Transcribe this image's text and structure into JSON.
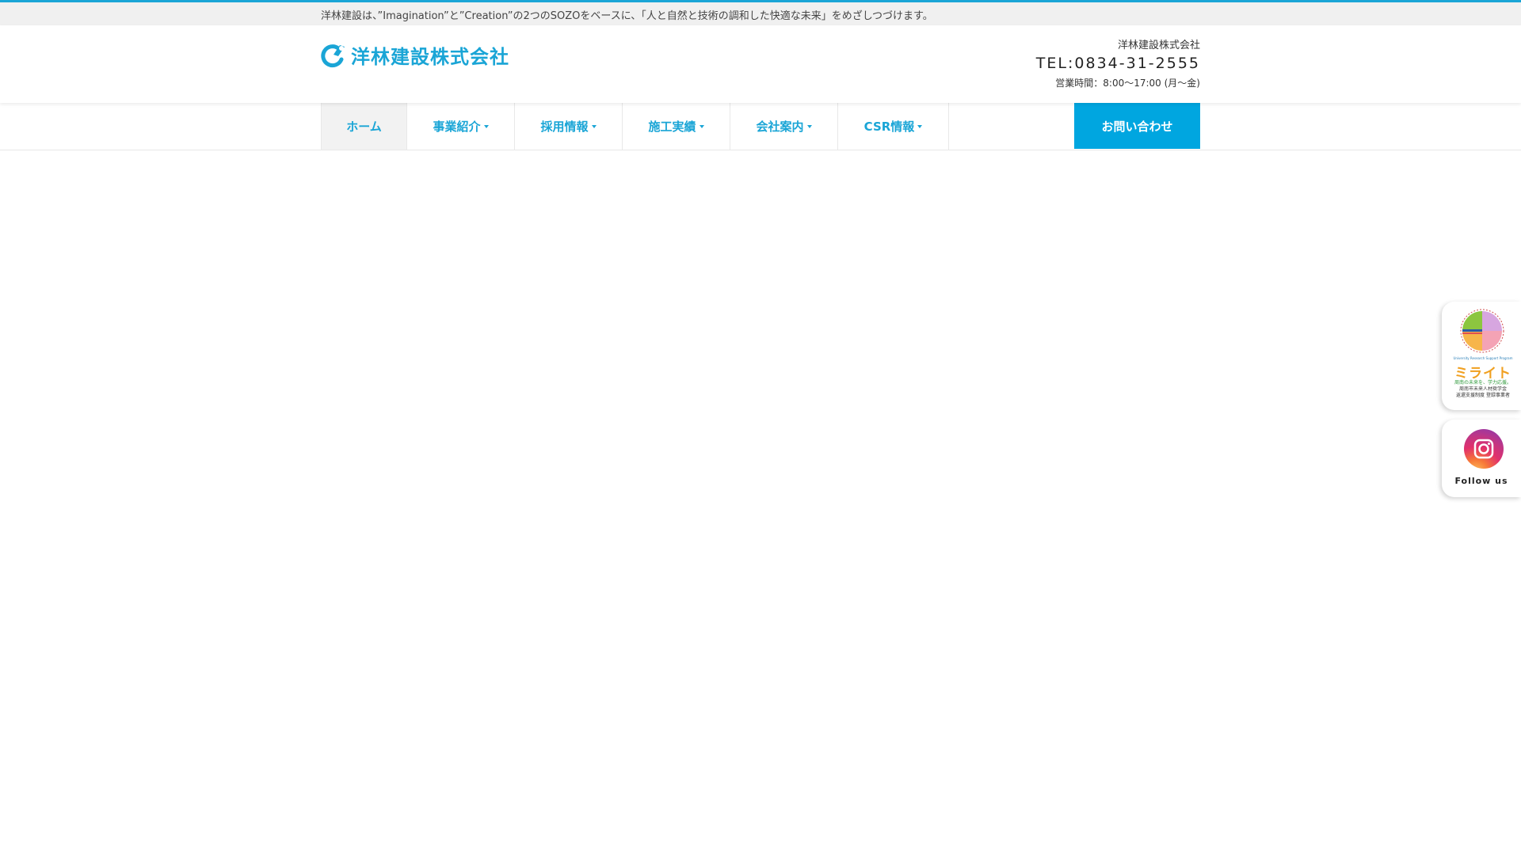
{
  "topbar": {
    "tagline": "洋林建設は、”Imagination”と”Creation”の2つのSOZOをベースに、「人と自然と技術の調和した快適な未来」をめざしつづけます。"
  },
  "header": {
    "logo_text": "洋林建設株式会社",
    "company_name": "洋林建設株式会社",
    "tel": "TEL:0834-31-2555",
    "hours": "営業時間：8:00～17:00 (月～金)"
  },
  "nav": {
    "items": [
      {
        "label": "ホーム",
        "dropdown": false
      },
      {
        "label": "事業紹介",
        "dropdown": true
      },
      {
        "label": "採用情報",
        "dropdown": true
      },
      {
        "label": "施工実績",
        "dropdown": true
      },
      {
        "label": "会社案内",
        "dropdown": true
      },
      {
        "label": "CSR情報",
        "dropdown": true
      }
    ],
    "contact_label": "お問い合わせ"
  },
  "side": {
    "mirai": {
      "small_text": "University Research Support Program",
      "title": "ミライト",
      "subtitle": "周南の未来を、学力応援。",
      "footer_line1": "周南市未来人材奨学金",
      "footer_line2": "返還支援制度 登録事業者"
    },
    "instagram": {
      "label": "Follow us",
      "icon": "instagram-icon"
    }
  },
  "colors": {
    "brand": "#1aa5d6",
    "contact_button": "#00a6e0"
  }
}
